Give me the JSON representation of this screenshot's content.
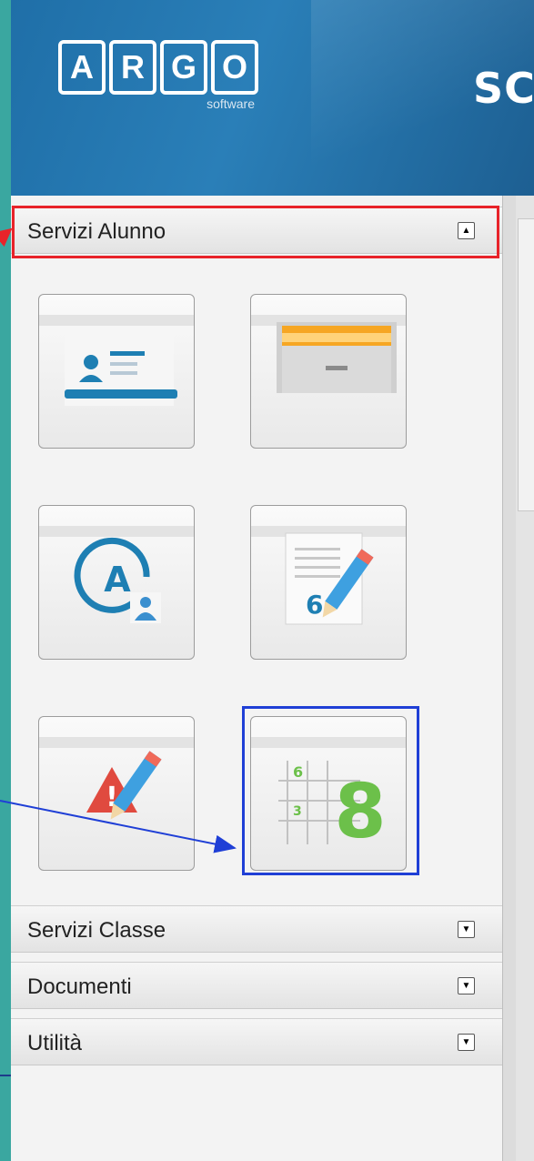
{
  "header": {
    "logo_letters": [
      "A",
      "R",
      "G",
      "O"
    ],
    "logo_sub": "software",
    "title_fragment": "SC"
  },
  "sections": [
    {
      "label": "Servizi Alunno",
      "toggle": "▲",
      "expanded": true,
      "selected": true
    },
    {
      "label": "Servizi Classe",
      "toggle": "▼",
      "expanded": false
    },
    {
      "label": "Documenti",
      "toggle": "▼",
      "expanded": false
    },
    {
      "label": "Utilità",
      "toggle": "▼",
      "expanded": false
    }
  ],
  "tiles": [
    {
      "icon": "id-card-icon"
    },
    {
      "icon": "folder-archive-icon"
    },
    {
      "icon": "user-account-icon"
    },
    {
      "icon": "grade-document-icon",
      "digit": "6"
    },
    {
      "icon": "alert-edit-icon",
      "mark": "!"
    },
    {
      "icon": "grades-grid-icon",
      "grid_digits": [
        "6",
        "3"
      ],
      "big_digit": "8",
      "highlighted": true
    }
  ],
  "colors": {
    "accent_green": "#3aa7a0",
    "header_blue": "#2a7fb8",
    "highlight_red": "#e8232a",
    "highlight_blue": "#1f3fd6",
    "icon_blue": "#1e7fb3",
    "icon_green": "#6cc04a",
    "alert_red": "#e04a3f"
  }
}
